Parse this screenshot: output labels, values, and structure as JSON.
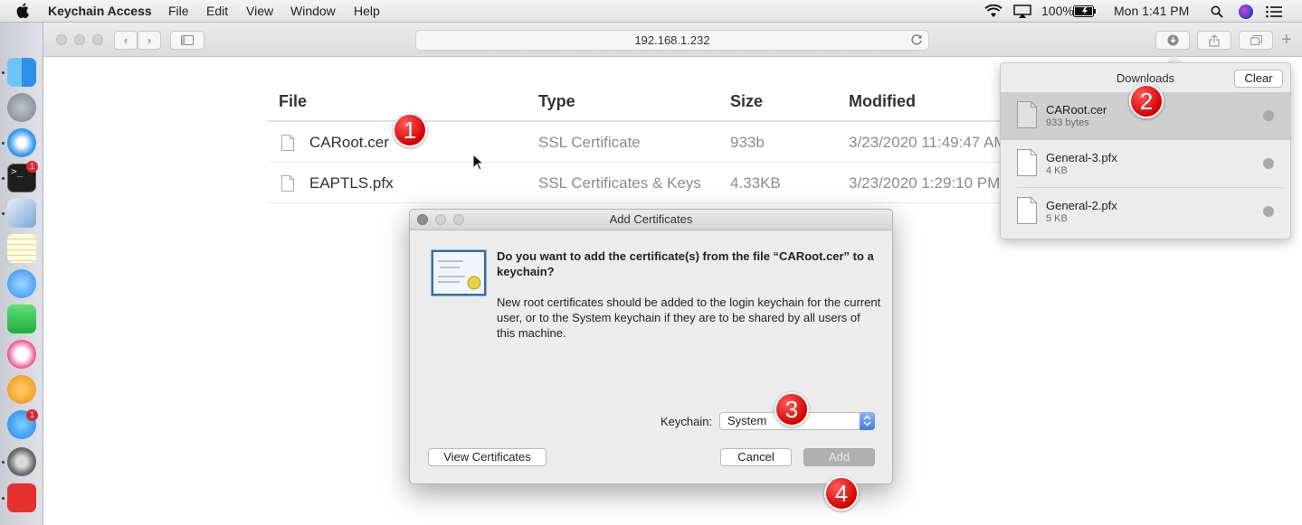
{
  "menubar": {
    "app_name": "Keychain Access",
    "menus": [
      "File",
      "Edit",
      "View",
      "Window",
      "Help"
    ],
    "battery": "100%",
    "clock": "Mon 1:41 PM",
    "icons": [
      "apple-icon",
      "wifi-icon",
      "airplay-icon",
      "battery-icon",
      "spotlight-icon",
      "siri-icon",
      "notification-center-icon"
    ]
  },
  "dock": {
    "apps": [
      "finder",
      "launchpad",
      "safari",
      "terminal",
      "preview",
      "notes",
      "messages",
      "facetime",
      "itunes",
      "ibooks",
      "app-store",
      "system-preferences",
      "anydesk"
    ],
    "terminal_badge": "1",
    "app_store_badge": "1"
  },
  "browser": {
    "url": "192.168.1.232"
  },
  "file_list": {
    "headers": {
      "file": "File",
      "type": "Type",
      "size": "Size",
      "modified": "Modified"
    },
    "rows": [
      {
        "name": "CARoot.cer",
        "type": "SSL Certificate",
        "size": "933b",
        "modified": "3/23/2020 11:49:47 AM"
      },
      {
        "name": "EAPTLS.pfx",
        "type": "SSL Certificates & Keys",
        "size": "4.33KB",
        "modified": "3/23/2020 1:29:10 PM"
      }
    ]
  },
  "downloads": {
    "title": "Downloads",
    "clear_label": "Clear",
    "items": [
      {
        "name": "CARoot.cer",
        "size": "933 bytes"
      },
      {
        "name": "General-3.pfx",
        "size": "4 KB"
      },
      {
        "name": "General-2.pfx",
        "size": "5 KB"
      }
    ]
  },
  "dialog": {
    "title": "Add Certificates",
    "question": "Do you want to add the certificate(s) from the file “CARoot.cer” to a keychain?",
    "body": "New root certificates should be added to the login keychain for the current user, or to the System keychain if they are to be shared by all users of this machine.",
    "keychain_label": "Keychain:",
    "keychain_value": "System",
    "view_certificates_label": "View Certificates",
    "cancel_label": "Cancel",
    "add_label": "Add"
  },
  "markers": [
    "1",
    "2",
    "3",
    "4"
  ],
  "colors": {
    "marker_red": "#e00000",
    "selection_gray": "#cfcfcf",
    "stepper_blue": "#3f7fe0"
  }
}
